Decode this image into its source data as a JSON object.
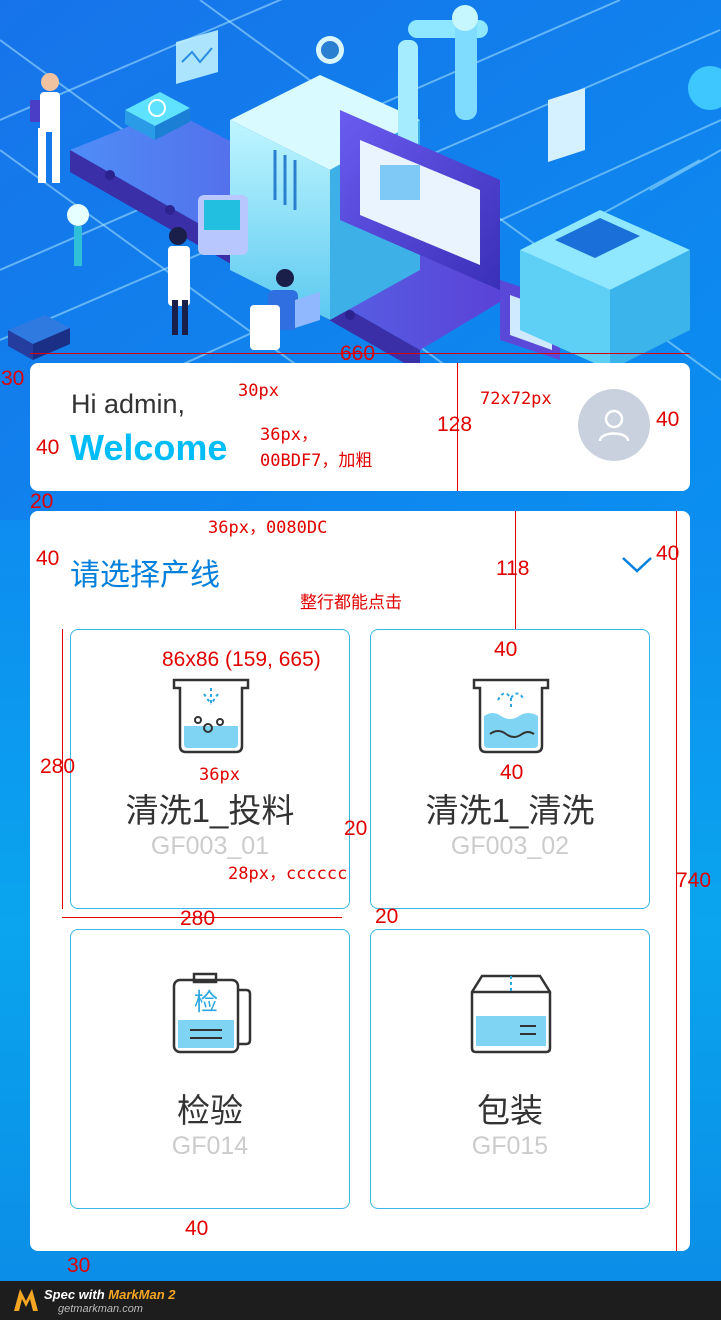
{
  "greeting": {
    "hi": "Hi admin,",
    "welcome": "Welcome",
    "avatar_icon": "user-avatar-icon",
    "welcome_color": "#00BDF7"
  },
  "picker": {
    "title": "请选择产线",
    "title_color": "#0080DC",
    "toggle_icon": "chevron-down-icon"
  },
  "lines": [
    {
      "name": "清洗1_投料",
      "code": "GF003_01",
      "icon": "feeding-tank-icon"
    },
    {
      "name": "清洗1_清洗",
      "code": "GF003_02",
      "icon": "washing-tank-icon"
    },
    {
      "name": "检验",
      "code": "GF014",
      "icon": "inspection-box-icon"
    },
    {
      "name": "包装",
      "code": "GF015",
      "icon": "packaging-box-icon"
    }
  ],
  "annotations": {
    "width_660": "660",
    "margin_30": "30",
    "size_30px": "30px",
    "size_72": "72x72px",
    "height_128": "128",
    "margin_40_a": "40",
    "margin_40_b": "40",
    "welcome_spec_1": "36px，",
    "welcome_spec_2": "00BDF7，加粗",
    "gap_20": "20",
    "title_spec": "36px，0080DC",
    "margin_40_c": "40",
    "margin_40_d": "40",
    "height_118": "118",
    "click_note": "整行都能点击",
    "icon_spec": "86x86 (159, 665)",
    "icon_top_40": "40",
    "icon_bottom_40": "40",
    "card_280_v": "280",
    "name_spec": "36px",
    "gap_20_b": "20",
    "code_spec": "28px，cccccc",
    "card_280_h": "280",
    "gap_20_c": "20",
    "panel_740": "740",
    "bottom_40": "40",
    "bottom_30": "30"
  },
  "footer": {
    "brand_prefix": "Spec with ",
    "brand_name": "MarkMan 2",
    "site": "getmarkman.com"
  }
}
